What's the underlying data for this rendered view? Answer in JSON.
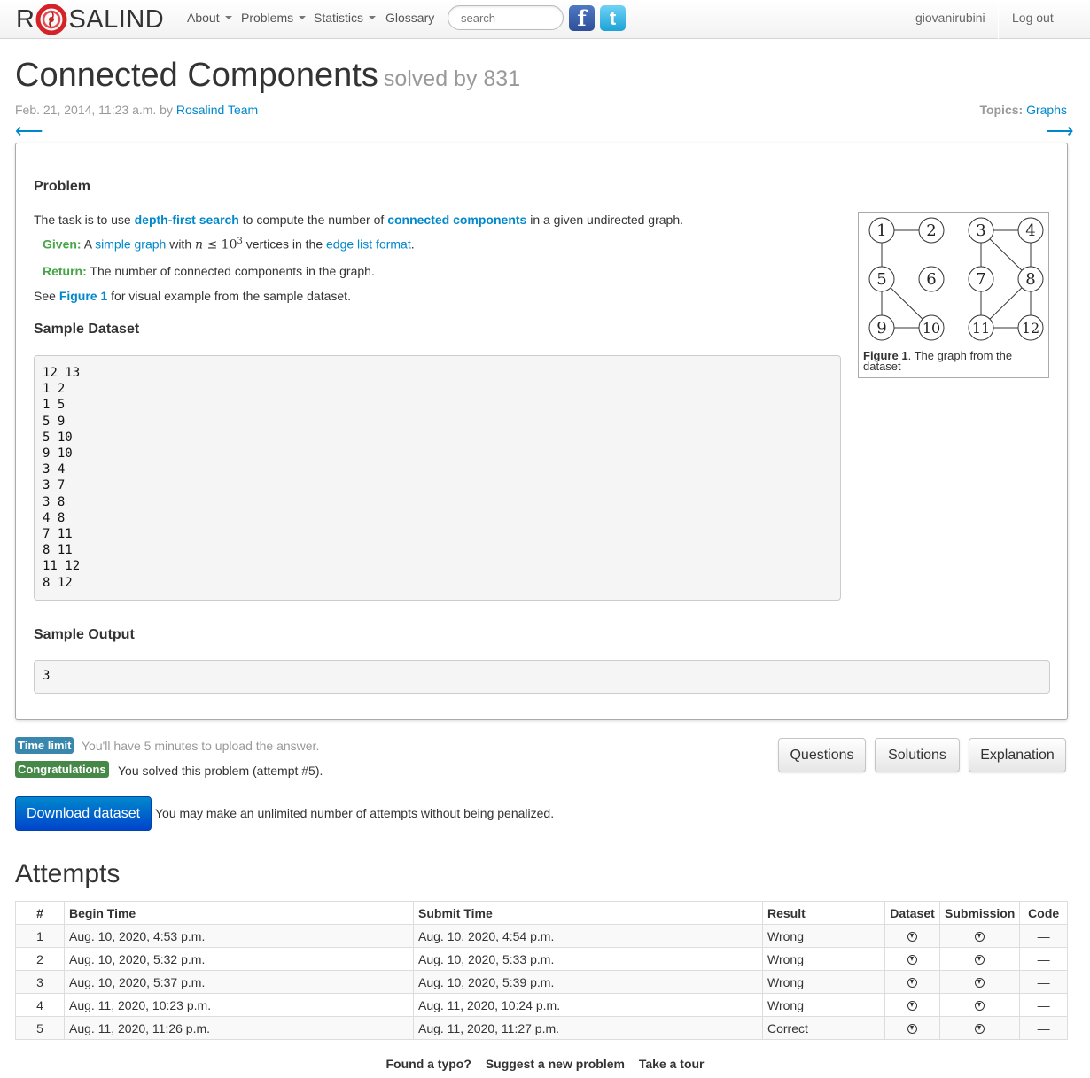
{
  "nav": {
    "logo_left": "R",
    "logo_right": "SALIND",
    "items": [
      "About",
      "Problems",
      "Statistics",
      "Glossary"
    ],
    "search_placeholder": "search",
    "facebook": "f",
    "twitter": "t",
    "username": "giovanirubini",
    "logout": "Log out"
  },
  "header": {
    "title": "Connected Components",
    "solved_by": "solved by 831",
    "date": "Feb. 21, 2014, 11:23 a.m. by ",
    "author": "Rosalind Team",
    "topics_label": "Topics:",
    "topic": "Graphs",
    "prev_arrow": "⟵",
    "next_arrow": "⟶"
  },
  "problem": {
    "heading": "Problem",
    "intro_1": "The task is to use ",
    "dfs_link": "depth-first search",
    "intro_2": " to compute the number of ",
    "cc_link": "connected components",
    "intro_3": " in a given undirected graph.",
    "given_label": "Given:",
    "given_1": " A ",
    "simple_graph": "simple graph",
    "given_2": " with ",
    "math_n": "n",
    "math_le": " ≤ 10",
    "math_exp": "3",
    "given_3": " vertices in the ",
    "edge_list": "edge list format",
    "given_4": ".",
    "return_label": "Return:",
    "return_text": " The number of connected components in the graph.",
    "see_1": "See ",
    "figure_link": "Figure 1",
    "see_2": " for visual example from the sample dataset.",
    "sample_dataset_heading": "Sample Dataset",
    "sample_dataset": [
      "12 13",
      "1 2",
      "1 5",
      "5 9",
      "5 10",
      "9 10",
      "3 4",
      "3 7",
      "3 8",
      "4 8",
      "7 11",
      "8 11",
      "11 12",
      "8 12"
    ],
    "sample_output_heading": "Sample Output",
    "sample_output": "3",
    "figure_caption_bold": "Figure 1",
    "figure_caption": ". The graph from the dataset",
    "graph_nodes": [
      "1",
      "2",
      "3",
      "4",
      "5",
      "6",
      "7",
      "8",
      "9",
      "10",
      "11",
      "12"
    ]
  },
  "status": {
    "time_limit_label": "Time limit",
    "time_limit_text": "You'll have 5 minutes to upload the answer.",
    "congrats_label": "Congratulations",
    "congrats_text": "You solved this problem (attempt #5).",
    "download_button": "Download dataset",
    "download_note": "You may make an unlimited number of attempts without being penalized.",
    "buttons": [
      "Questions",
      "Solutions",
      "Explanation"
    ]
  },
  "attempts": {
    "title": "Attempts",
    "columns": [
      "#",
      "Begin Time",
      "Submit Time",
      "Result",
      "Dataset",
      "Submission",
      "Code"
    ],
    "rows": [
      {
        "n": "1",
        "begin": "Aug. 10, 2020, 4:53 p.m.",
        "submit": "Aug. 10, 2020, 4:54 p.m.",
        "result": "Wrong",
        "code": "—"
      },
      {
        "n": "2",
        "begin": "Aug. 10, 2020, 5:32 p.m.",
        "submit": "Aug. 10, 2020, 5:33 p.m.",
        "result": "Wrong",
        "code": "—"
      },
      {
        "n": "3",
        "begin": "Aug. 10, 2020, 5:37 p.m.",
        "submit": "Aug. 10, 2020, 5:39 p.m.",
        "result": "Wrong",
        "code": "—"
      },
      {
        "n": "4",
        "begin": "Aug. 11, 2020, 10:23 p.m.",
        "submit": "Aug. 11, 2020, 10:24 p.m.",
        "result": "Wrong",
        "code": "—"
      },
      {
        "n": "5",
        "begin": "Aug. 11, 2020, 11:26 p.m.",
        "submit": "Aug. 11, 2020, 11:27 p.m.",
        "result": "Correct",
        "code": "—"
      }
    ]
  },
  "footer": {
    "links": [
      "Found a typo?",
      "Suggest a new problem",
      "Take a tour"
    ]
  }
}
